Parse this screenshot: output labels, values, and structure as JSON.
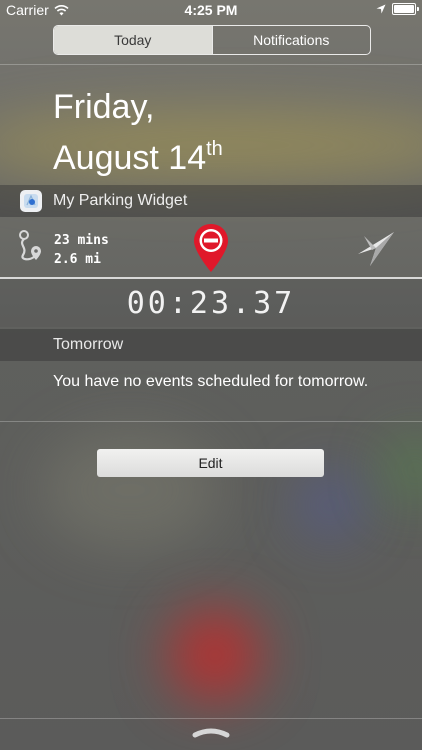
{
  "status_bar": {
    "carrier": "Carrier",
    "time": "4:25 PM"
  },
  "tabs": [
    {
      "label": "Today",
      "active": true
    },
    {
      "label": "Notifications",
      "active": false
    }
  ],
  "date": {
    "weekday": "Friday,",
    "month_day": "August 14",
    "suffix": "th"
  },
  "widget": {
    "title": "My Parking Widget",
    "icon": "parking-app-icon",
    "travel_time": "23 mins",
    "distance": "2.6 mi",
    "timer": "00:23.37"
  },
  "tomorrow": {
    "title": "Tomorrow",
    "message": "You have no events scheduled for tomorrow."
  },
  "edit_label": "Edit",
  "colors": {
    "pin_red": "#e0182a",
    "edit_button": "#e8e8e7"
  }
}
